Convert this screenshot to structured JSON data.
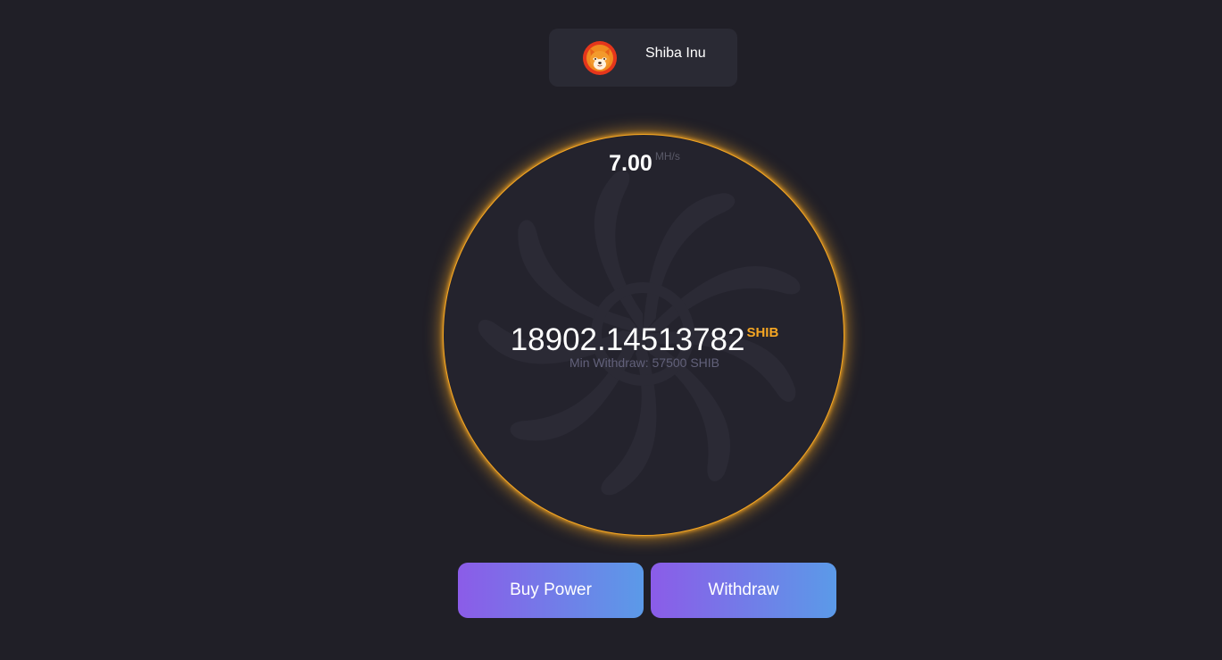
{
  "coin": {
    "name": "Shiba Inu",
    "logo_icon": "shiba-inu-logo"
  },
  "miner": {
    "hashrate_value": "7.00",
    "hashrate_unit": "MH/s",
    "balance_value": "18902.14513782",
    "balance_unit": "SHIB",
    "min_withdraw_text": "Min Withdraw: 57500 SHIB"
  },
  "actions": {
    "buy_power_label": "Buy Power",
    "withdraw_label": "Withdraw"
  },
  "colors": {
    "background": "#201f27",
    "accent_glow": "#f5a623",
    "button_gradient_start": "#8b5ce8",
    "button_gradient_end": "#5b9ae8"
  }
}
